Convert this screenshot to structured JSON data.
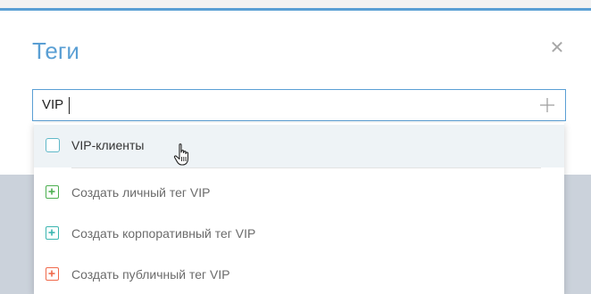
{
  "dialog": {
    "title": "Теги",
    "close_icon": "close-icon"
  },
  "tag_input": {
    "value": "VIP",
    "add_icon": "plus-icon"
  },
  "dropdown": {
    "existing_tag": {
      "label": "VIP-клиенты",
      "checked": false
    },
    "create_personal": {
      "label": "Создать личный тег VIP",
      "icon": "plus-square-icon",
      "color": "#4caf50"
    },
    "create_corporate": {
      "label": "Создать корпоративный тег VIP",
      "icon": "plus-square-icon",
      "color": "#3bb5b0"
    },
    "create_public": {
      "label": "Создать публичный тег VIP",
      "icon": "plus-square-icon",
      "color": "#f0694a"
    }
  },
  "colors": {
    "accent": "#5a9fd4",
    "backdrop": "#cbd2db",
    "hover_row": "#eef3f6"
  }
}
